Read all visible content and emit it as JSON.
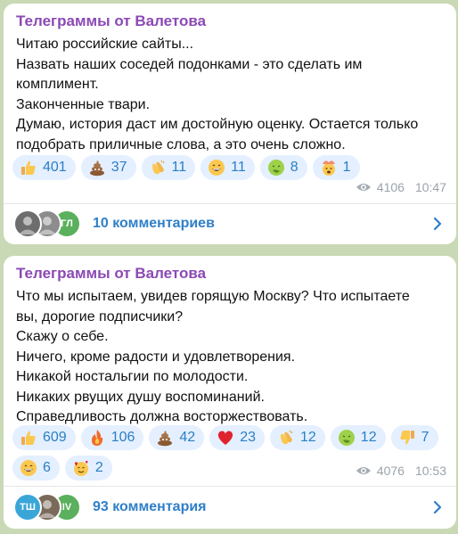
{
  "posts": [
    {
      "channel": "Телеграммы от Валетова",
      "lines": [
        "Читаю российские сайты...",
        "Назвать наших соседей подонками - это сделать им",
        "комплимент.",
        "Законченные твари.",
        "Думаю, история даст им достойную оценку. Остается только",
        "подобрать приличные слова, а это очень сложно."
      ],
      "reactions": [
        {
          "icon": "thumbs-up-icon",
          "count": "401"
        },
        {
          "icon": "poop-icon",
          "count": "37"
        },
        {
          "icon": "clapping-hands-icon",
          "count": "11"
        },
        {
          "icon": "grinning-face-icon",
          "count": "11"
        },
        {
          "icon": "nauseated-face-icon",
          "count": "8"
        },
        {
          "icon": "exploding-head-icon",
          "count": "1"
        }
      ],
      "views": "4106",
      "time": "10:47",
      "comments_label": "10 комментариев",
      "avatars": [
        {
          "icon": "photo-avatar-1",
          "text": "",
          "color": "#6d6d6d"
        },
        {
          "icon": "photo-avatar-2",
          "text": "",
          "color": "#8c8c8c"
        },
        {
          "icon": "initials-avatar",
          "text": "ГЛ",
          "color": "#5ab05c"
        }
      ]
    },
    {
      "channel": "Телеграммы от Валетова",
      "lines": [
        "Что мы испытаем, увидев горящую Москву? Что испытаете",
        "вы, дорогие подписчики?",
        "Скажу о себе.",
        "Ничего, кроме радости и удовлетворения.",
        "Никакой ностальгии по молодости.",
        "Никаких рвущих душу воспоминаний.",
        "Справедливость должна восторжествовать."
      ],
      "reactions": [
        {
          "icon": "thumbs-up-icon",
          "count": "609"
        },
        {
          "icon": "fire-icon",
          "count": "106"
        },
        {
          "icon": "poop-icon",
          "count": "42"
        },
        {
          "icon": "red-heart-icon",
          "count": "23"
        },
        {
          "icon": "clapping-hands-icon",
          "count": "12"
        },
        {
          "icon": "nauseated-face-icon",
          "count": "12"
        },
        {
          "icon": "thumbs-down-icon",
          "count": "7"
        },
        {
          "icon": "grinning-face-icon",
          "count": "6"
        },
        {
          "icon": "smiling-face-with-hearts-icon",
          "count": "2"
        }
      ],
      "views": "4076",
      "time": "10:53",
      "comments_label": "93 комментария",
      "avatars": [
        {
          "icon": "initials-avatar",
          "text": "ТШ",
          "color": "#3aa6d8"
        },
        {
          "icon": "photo-avatar-3",
          "text": "",
          "color": "#7a6a5a"
        },
        {
          "icon": "initials-avatar",
          "text": "IV",
          "color": "#5ab05c"
        }
      ]
    }
  ],
  "colors": {
    "channel": "#8b49b5",
    "accent": "#2f7fc8",
    "chip_bg": "#e4efff",
    "chat_bg": "#cad9b5"
  }
}
